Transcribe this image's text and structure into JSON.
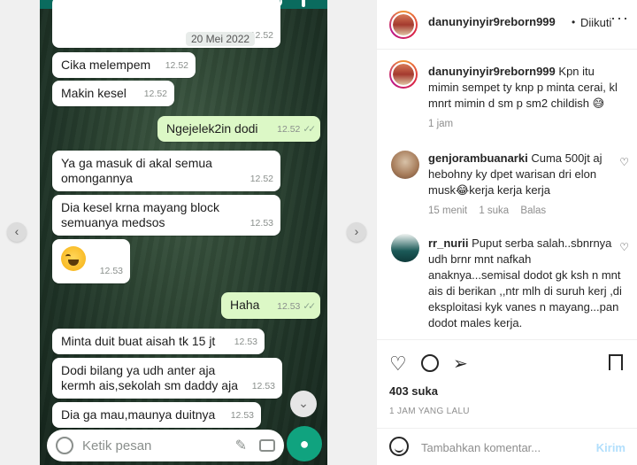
{
  "screenshot": {
    "date_chip": "20 Mei 2022",
    "bubbles": [
      {
        "text": "Cika melempem",
        "time": "12.52"
      },
      {
        "text": "Makin kesel",
        "time": "12.52"
      },
      {
        "text": "Ngejelek2in dodi",
        "time": "12.52"
      },
      {
        "text": "Ya ga masuk di akal semua omongannya",
        "time": "12.52"
      },
      {
        "text": "Dia kesel krna mayang block semuanya medsos",
        "time": "12.53"
      },
      {
        "text": "",
        "time": "12.53"
      },
      {
        "text": "Haha",
        "time": "12.53"
      },
      {
        "text": "Minta duit buat aisah tk 15 jt",
        "time": "12.53"
      },
      {
        "text": "Dodi bilang ya udh anter aja kermh ais,sekolah sm daddy aja",
        "time": "12.53"
      },
      {
        "text": "Dia ga mau,maunya duitnya",
        "time": "12.53"
      }
    ],
    "top_time": "12.52",
    "input_placeholder": "Ketik pesan"
  },
  "header": {
    "username": "danunyinyir9reborn999",
    "dot": "•",
    "follow_label": "Diikuti",
    "more": "···"
  },
  "caption": {
    "username": "danunyinyir9reborn999",
    "text": "Kpn itu mimin sempet ty knp p minta cerai, kl mnrt mimin d sm p sm2 childish 😅",
    "time": "1 jam"
  },
  "comments": [
    {
      "username": "genjorambuanarki",
      "text": "Cuma 500jt aj hebohny ky dpet warisan dri elon musk😂kerja kerja kerja",
      "time": "15 menit",
      "likes": "1 suka",
      "reply": "Balas"
    },
    {
      "username": "rr_nurii",
      "text": "Puput serba salah..sbnrnya udh brnr mnt nafkah anaknya...semisal dodot gk ksh n mnt ais di berikan ,,ntr mlh di suruh kerj ,di eksploitasi kyk vanes n mayang...pan dodot males kerja."
    }
  ],
  "likes": "403 suka",
  "timestamp": "1 JAM YANG LALU",
  "add_comment": {
    "placeholder": "Tambahkan komentar...",
    "send": "Kirim"
  }
}
